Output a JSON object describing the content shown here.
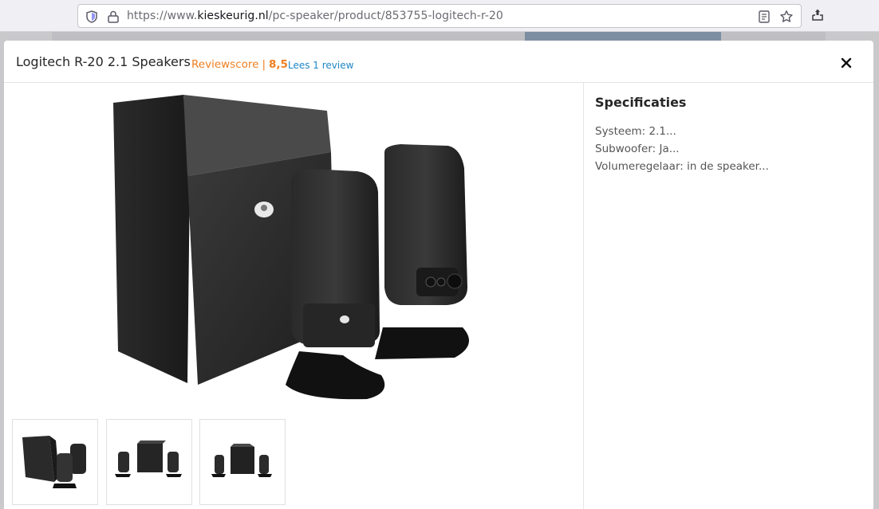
{
  "browser": {
    "url_prefix": "https://www.",
    "url_domain": "kieskeurig.nl",
    "url_path": "/pc-speaker/product/853755-logitech-r-20"
  },
  "modal": {
    "title": "Logitech R-20 2.1 Speakers",
    "score_label": "Reviewscore",
    "score_separator": "|",
    "score_value": "8,5",
    "review_link": "Lees 1 review",
    "close_label": "×"
  },
  "specs": {
    "heading": "Specificaties",
    "rows": [
      "Systeem: 2.1...",
      "Subwoofer: Ja...",
      "Volumeregelaar: in de speaker..."
    ]
  },
  "colors": {
    "accent_orange": "#ef8022",
    "link_blue": "#1f86c8"
  }
}
